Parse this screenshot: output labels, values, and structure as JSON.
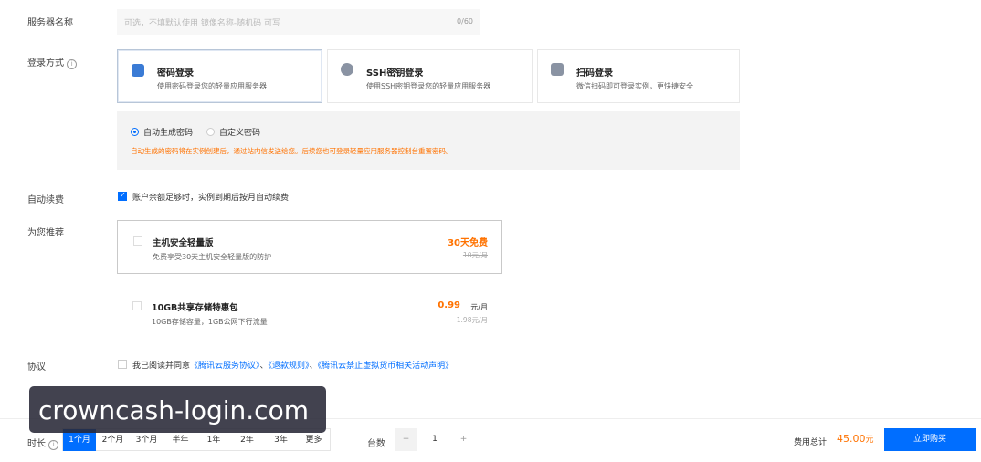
{
  "server_name": {
    "label": "服务器名称",
    "placeholder": "可选，不填默认使用 镜像名称-随机码 可写",
    "counter": "0/60"
  },
  "login": {
    "label": "登录方式",
    "options": [
      {
        "title": "密码登录",
        "desc": "使用密码登录您的轻量应用服务器",
        "icon": "password-icon"
      },
      {
        "title": "SSH密钥登录",
        "desc": "使用SSH密钥登录您的轻量应用服务器",
        "icon": "key-icon"
      },
      {
        "title": "扫码登录",
        "desc": "微信扫码即可登录实例，更快捷安全",
        "icon": "qrcode-icon"
      }
    ],
    "radio_auto": "自动生成密码",
    "radio_custom": "自定义密码",
    "hint": "自动生成的密码将在实例创建后，通过站内信发送给您。后续您也可登录轻量应用服务器控制台重置密码。"
  },
  "auto_renew": {
    "label": "自动续费",
    "text": "账户余额足够时，实例到期后按月自动续费"
  },
  "recommend": {
    "label": "为您推荐",
    "items": [
      {
        "title": "主机安全轻量版",
        "desc": "免费享受30天主机安全轻量版的防护",
        "price": "30天免费",
        "orig": "10元/月"
      },
      {
        "title": "10GB共享存储特惠包",
        "desc": "10GB存储容量，1GB公网下行流量",
        "price": "0.99",
        "unit": "元/月",
        "orig": "1.98元/月"
      }
    ]
  },
  "agreement": {
    "label": "协议",
    "prefix": "我已阅读并同意",
    "link1": "《腾讯云服务协议》",
    "sep1": "、",
    "link2": "《退款规则》",
    "sep2": "、",
    "link3": "《腾讯云禁止虚拟货币相关活动声明》"
  },
  "watermark": "crowncash-login.com",
  "duration": {
    "label": "时长",
    "options": [
      "1个月",
      "2个月",
      "3个月",
      "半年",
      "1年",
      "2年",
      "3年",
      "更多"
    ],
    "selected": 0
  },
  "quantity": {
    "label": "台数",
    "value": "1",
    "minus": "−",
    "plus": "+"
  },
  "total": {
    "label": "费用总计",
    "amount": "45.00",
    "unit": "元"
  },
  "buy_button": "立即购买",
  "colors": {
    "accent": "#006eff",
    "orange": "#ff7200",
    "hint": "#ff7200"
  }
}
